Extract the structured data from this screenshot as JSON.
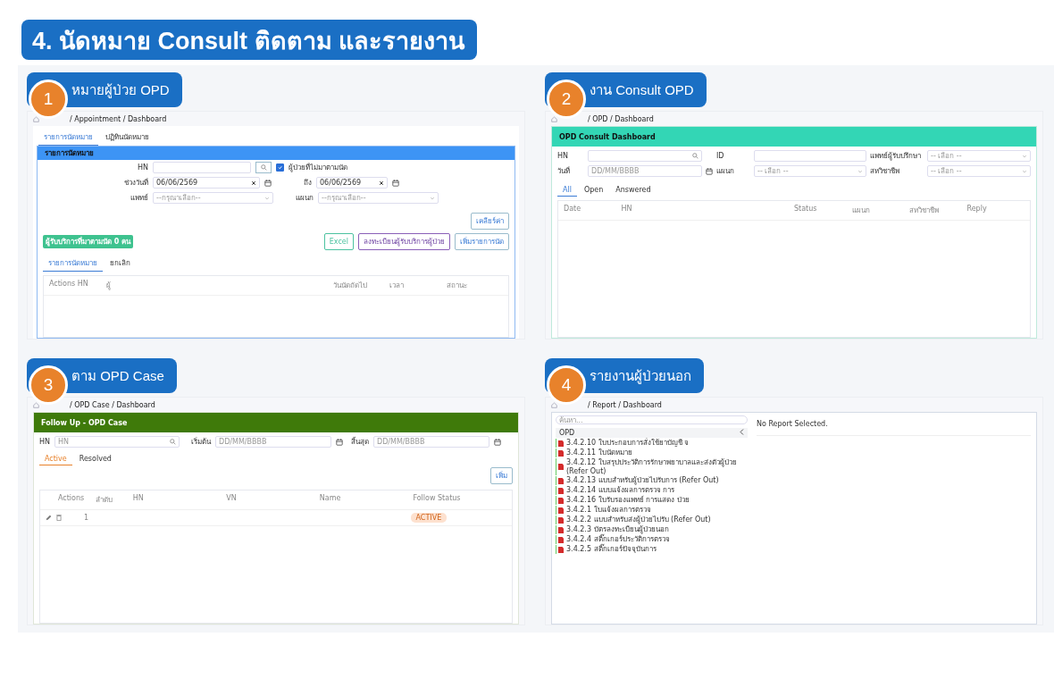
{
  "title": "4. นัดหมาย Consult ติดตาม และรายงาน",
  "appointment": {
    "number": "1",
    "title": "หมายผู้ป่วย OPD",
    "breadcrumb": "/ Appointment / Dashboard",
    "tabs": [
      {
        "label": "รายการนัดหมาย",
        "selected": true
      },
      {
        "label": "ปฏิทินนัดหมาย",
        "selected": false
      }
    ],
    "header": "รายการนัดหมาย",
    "hn_label": "HN",
    "missed": {
      "label": "ผู้ป่วยที่ไม่มาตามนัด",
      "checked": true
    },
    "from_label": "ช่วงวันที่",
    "from_value": "06/06/2569",
    "to_label": "ถึง",
    "to_value": "06/06/2569",
    "doctor_label": "แพทย์",
    "doctor_value": "--กรุณาเลือก--",
    "dept_label": "แผนก",
    "dept_value": "--กรุณาเลือก--",
    "clear_button": "เคลียร์ค่า",
    "count_badge": "ผู้รับบริการที่มาตามนัด 0 คน",
    "buttons": [
      {
        "kind": "excel",
        "label": "Excel"
      },
      {
        "kind": "register",
        "label": "ลงทะเบียนผู้รับบริการผู้ป่วย"
      },
      {
        "kind": "add",
        "label": "เพิ่มรายการนัด"
      }
    ],
    "subtabs": [
      {
        "label": "รายการนัดหมาย",
        "selected": true
      },
      {
        "label": "ยกเลิก",
        "selected": false
      }
    ],
    "columns": [
      "Actions",
      "HN",
      "ผู้",
      "วันนัดถัดไป",
      "เวลา",
      "สถานะ"
    ]
  },
  "consult": {
    "number": "2",
    "title": "งาน Consult OPD",
    "breadcrumb": "/ OPD / Dashboard",
    "header": "OPD Consult Dashboard",
    "hn_label": "HN",
    "id_label": "ID",
    "doctor_label": "แพทย์ผู้รับปรึกษา",
    "doctor_value": "-- เลือก --",
    "date_label": "วันที่",
    "date_placeholder": "DD/MM/BBBB",
    "dept_label": "แผนก",
    "dept_value": "-- เลือก --",
    "team_label": "สหวิชาชีพ",
    "team_value": "-- เลือก --",
    "tabs": [
      {
        "label": "All",
        "selected": true
      },
      {
        "label": "Open",
        "selected": false
      },
      {
        "label": "Answered",
        "selected": false
      }
    ],
    "columns": [
      "Date",
      "HN",
      "",
      "",
      "Status",
      "แผนก",
      "สหวิชาชีพ",
      "Reply"
    ]
  },
  "followup": {
    "number": "3",
    "title": "ตาม OPD Case",
    "breadcrumb": "/ OPD Case / Dashboard",
    "header": "Follow Up - OPD Case",
    "hn_label": "HN",
    "hn_placeholder": "HN",
    "start_label": "เริ่มต้น",
    "start_placeholder": "DD/MM/BBBB",
    "end_label": "สิ้นสุด",
    "end_placeholder": "DD/MM/BBBB",
    "tabs": [
      {
        "label": "Active",
        "selected": true
      },
      {
        "label": "Resolved",
        "selected": false
      }
    ],
    "add_button": "เพิ่ม",
    "columns": [
      "Actions",
      "ลำดับ",
      "HN",
      "VN",
      "Name",
      "Follow Status"
    ],
    "rows": [
      {
        "index": "1",
        "status": "ACTIVE"
      }
    ]
  },
  "report": {
    "number": "4",
    "title": "รายงานผู้ป่วยนอก",
    "breadcrumb": "/ Report / Dashboard",
    "search_placeholder": "ค้นหา...",
    "group": "OPD",
    "empty_text": "No Report Selected.",
    "items": [
      "3.4.2.10 ใบประกอบการสั่งใช้ยาบัญชี จ",
      "3.4.2.11 ใบนัดหมาย",
      "3.4.2.12 ใบสรุปประวัติการรักษาพยาบาลและส่งตัวผู้ป่วย (Refer Out)",
      "3.4.2.13 แบบสำหรับผู้ป่วยไปรับการ (Refer Out)",
      "3.4.2.14 แบบแจ้งผลการตรวจ การ",
      "3.4.2.16 ใบรับรองแพทย์ การแสดง ป่วย",
      "3.4.2.1 ใบแจ้งผลการตรวจ",
      "3.4.2.2 แบบสำหรับส่งผู้ป่วยไปรับ (Refer Out)",
      "3.4.2.3 บัตรลงทะเบียนผู้ป่วยนอก",
      "3.4.2.4 สติ๊กเกอร์ประวัติการตรวจ",
      "3.4.2.5 สติ๊กเกอร์ปัจจุบันการ"
    ]
  }
}
